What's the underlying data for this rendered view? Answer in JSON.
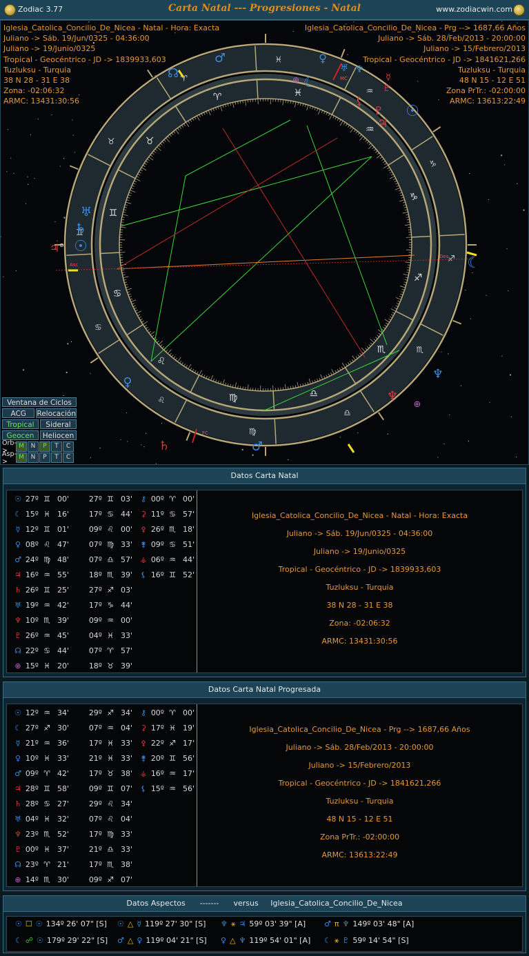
{
  "window": {
    "app_name": "Zodiac 3.77",
    "title": "Carta Natal --- Progresiones - Natal",
    "url": "www.zodiacwin.com"
  },
  "natal_info": [
    "Iglesia_Catolica_Concilio_De_Nicea - Natal - Hora: Exacta",
    "Juliano -> Sáb. 19/Jun/0325 - 04:36:00",
    "Juliano -> 19/Junio/0325",
    "Tropical - Geocéntrico - JD -> 1839933,603",
    "Tuzluksu - Turquia",
    "38 N 28 - 31 E 38",
    "Zona: -02:06:32",
    "ARMC: 13431:30:56"
  ],
  "prog_info": [
    "Iglesia_Catolica_Concilio_De_Nicea - Prg --> 1687,66 Años",
    "Juliano -> Sáb. 28/Feb/2013 - 20:00:00",
    "Juliano -> 15/Febrero/2013",
    "Tropical - Geocéntrico - JD -> 1841621,266",
    "Tuzluksu - Turquia",
    "48 N 15 - 12 E 51",
    "Zona PrTr.: -02:00:00",
    "ARMC: 13613:22:49"
  ],
  "wheel": {
    "signs": [
      "♈",
      "♉",
      "♊",
      "♋",
      "♌",
      "♍",
      "♎",
      "♏",
      "♐",
      "♑",
      "♒",
      "♓"
    ],
    "asc_label": "Asc",
    "desc_label": "Des.",
    "mc_label": "MC",
    "ic_label": "FC",
    "d_label": "D",
    "colors": {
      "outer": "#2a3a44",
      "ring": "#b8a878",
      "inner": "#0b1a22",
      "line_green": "#3adc3a",
      "line_red": "#c0302a",
      "line_orange": "#e08030"
    }
  },
  "buttons": {
    "ciclos": "Ventana de Ciclos",
    "acg": "ACG",
    "relocacion": "Relocación",
    "tropical": "Tropical",
    "sideral": "Sideral",
    "geocen": "Geocen",
    "heliocen": "Heliocen",
    "orb_label": "Orb->",
    "asp_label": "Asp->",
    "orb_cells": [
      "M",
      "N",
      "P",
      "T",
      "C"
    ],
    "asp_cells": [
      "M",
      "N",
      "P",
      "T",
      "C"
    ]
  },
  "natal_panel": {
    "title": "Datos Carta Natal",
    "positions": [
      [
        "☉",
        "27º",
        "♊",
        "00'",
        "27º",
        "♊",
        "03'",
        "⚷",
        "00º",
        "♈",
        "00'"
      ],
      [
        "☾",
        "15º",
        "♓",
        "16'",
        "17º",
        "♋",
        "44'",
        "⚳",
        "11º",
        "♋",
        "57'"
      ],
      [
        "☿",
        "12º",
        "♊",
        "01'",
        "09º",
        "♌",
        "00'",
        "⚴",
        "26º",
        "♏",
        "18'"
      ],
      [
        "♀",
        "08º",
        "♌",
        "47'",
        "07º",
        "♍",
        "33'",
        "⚵",
        "09º",
        "♋",
        "51'"
      ],
      [
        "♂",
        "24º",
        "♍",
        "48'",
        "07º",
        "♎",
        "57'",
        "⚶",
        "06º",
        "♒",
        "44'"
      ],
      [
        "♃",
        "16º",
        "♒",
        "55'",
        "18º",
        "♏",
        "39'",
        "⚸",
        "16º",
        "♊",
        "52'"
      ],
      [
        "♄",
        "26º",
        "♊",
        "25'",
        "27º",
        "♐",
        "03'",
        "",
        "",
        "",
        ""
      ],
      [
        "♅",
        "19º",
        "♒",
        "42'",
        "17º",
        "♑",
        "44'",
        "",
        "",
        "",
        ""
      ],
      [
        "♆",
        "10º",
        "♏",
        "39'",
        "09º",
        "♒",
        "00'",
        "",
        "",
        "",
        ""
      ],
      [
        "♇",
        "26º",
        "♒",
        "45'",
        "04º",
        "♓",
        "33'",
        "",
        "",
        "",
        ""
      ],
      [
        "☊",
        "22º",
        "♋",
        "44'",
        "07º",
        "♈",
        "57'",
        "",
        "",
        "",
        ""
      ],
      [
        "⊕",
        "15º",
        "♓",
        "20'",
        "18º",
        "♉",
        "39'",
        "",
        "",
        "",
        ""
      ]
    ],
    "info": [
      "Iglesia_Catolica_Concilio_De_Nicea - Natal - Hora: Exacta",
      "Juliano -> Sáb. 19/Jun/0325 - 04:36:00",
      "Juliano -> 19/Junio/0325",
      "Tropical - Geocéntrico - JD -> 1839933,603",
      "Tuzluksu - Turquia",
      "38 N 28 - 31 E 38",
      "Zona: -02:06:32",
      "ARMC: 13431:30:56"
    ]
  },
  "prog_panel": {
    "title": "Datos Carta Natal Progresada",
    "positions": [
      [
        "☉",
        "12º",
        "♒",
        "34'",
        "29º",
        "♐",
        "34'",
        "⚷",
        "00º",
        "♈",
        "00'"
      ],
      [
        "☾",
        "27º",
        "♐",
        "30'",
        "07º",
        "♒",
        "04'",
        "⚳",
        "17º",
        "♓",
        "19'"
      ],
      [
        "☿",
        "21º",
        "♒",
        "36'",
        "17º",
        "♓",
        "33'",
        "⚴",
        "22º",
        "♐",
        "17'"
      ],
      [
        "♀",
        "10º",
        "♓",
        "33'",
        "21º",
        "♓",
        "33'",
        "⚵",
        "20º",
        "♊",
        "56'"
      ],
      [
        "♂",
        "09º",
        "♈",
        "42'",
        "17º",
        "♉",
        "38'",
        "⚶",
        "16º",
        "♒",
        "17'"
      ],
      [
        "♃",
        "28º",
        "♊",
        "58'",
        "09º",
        "♊",
        "07'",
        "⚸",
        "15º",
        "♒",
        "56'"
      ],
      [
        "♄",
        "28º",
        "♋",
        "27'",
        "29º",
        "♌",
        "34'",
        "",
        "",
        "",
        ""
      ],
      [
        "♅",
        "04º",
        "♓",
        "32'",
        "07º",
        "♌",
        "04'",
        "",
        "",
        "",
        ""
      ],
      [
        "♆",
        "23º",
        "♏",
        "52'",
        "17º",
        "♍",
        "33'",
        "",
        "",
        "",
        ""
      ],
      [
        "♇",
        "00º",
        "♓",
        "37'",
        "21º",
        "♎",
        "33'",
        "",
        "",
        "",
        ""
      ],
      [
        "☊",
        "23º",
        "♈",
        "21'",
        "17º",
        "♏",
        "38'",
        "",
        "",
        "",
        ""
      ],
      [
        "⊕",
        "14º",
        "♏",
        "30'",
        "09º",
        "♐",
        "07'",
        "",
        "",
        "",
        ""
      ]
    ],
    "info": [
      "Iglesia_Catolica_Concilio_De_Nicea - Prg --> 1687,66 Años",
      "Juliano -> Sáb. 28/Feb/2013 - 20:00:00",
      "Juliano -> 15/Febrero/2013",
      "Tropical - Geocéntrico - JD -> 1841621,266",
      "Tuzluksu - Turquia",
      "48 N 15 - 12 E 51",
      "Zona PrTr.: -02:00:00",
      "ARMC: 13613:22:49"
    ]
  },
  "aspects_panel": {
    "title_a": "Datos Aspectos",
    "title_sep": "-------",
    "title_b": "versus",
    "title_c": "Iglesia_Catolica_Concilio_De_Nicea",
    "rows": [
      [
        {
          "p1": "☉",
          "asp": "☐",
          "p2": "☉",
          "val": "134º 26' 07\" [S]"
        },
        {
          "p1": "☉",
          "asp": "△",
          "p2": "☿",
          "val": "119º 27' 30\" [S]"
        },
        {
          "p1": "♆",
          "asp": "⚹",
          "p2": "♃",
          "val": "59º 03' 39\" [A]"
        },
        {
          "p1": "♂",
          "asp": "π",
          "p2": "♆",
          "val": "149º 03' 48\" [A]"
        }
      ],
      [
        {
          "p1": "☾",
          "asp": "☍",
          "p2": "☉",
          "val": "179º 29' 22\" [S]"
        },
        {
          "p1": "♂",
          "asp": "△",
          "p2": "♀",
          "val": "119º 04' 21\" [S]"
        },
        {
          "p1": "♀",
          "asp": "△",
          "p2": "♆",
          "val": "119º 54' 01\" [A]"
        },
        {
          "p1": "☾",
          "asp": "⚹",
          "p2": "♇",
          "val": "59º 14' 54\" [S]"
        }
      ]
    ]
  }
}
